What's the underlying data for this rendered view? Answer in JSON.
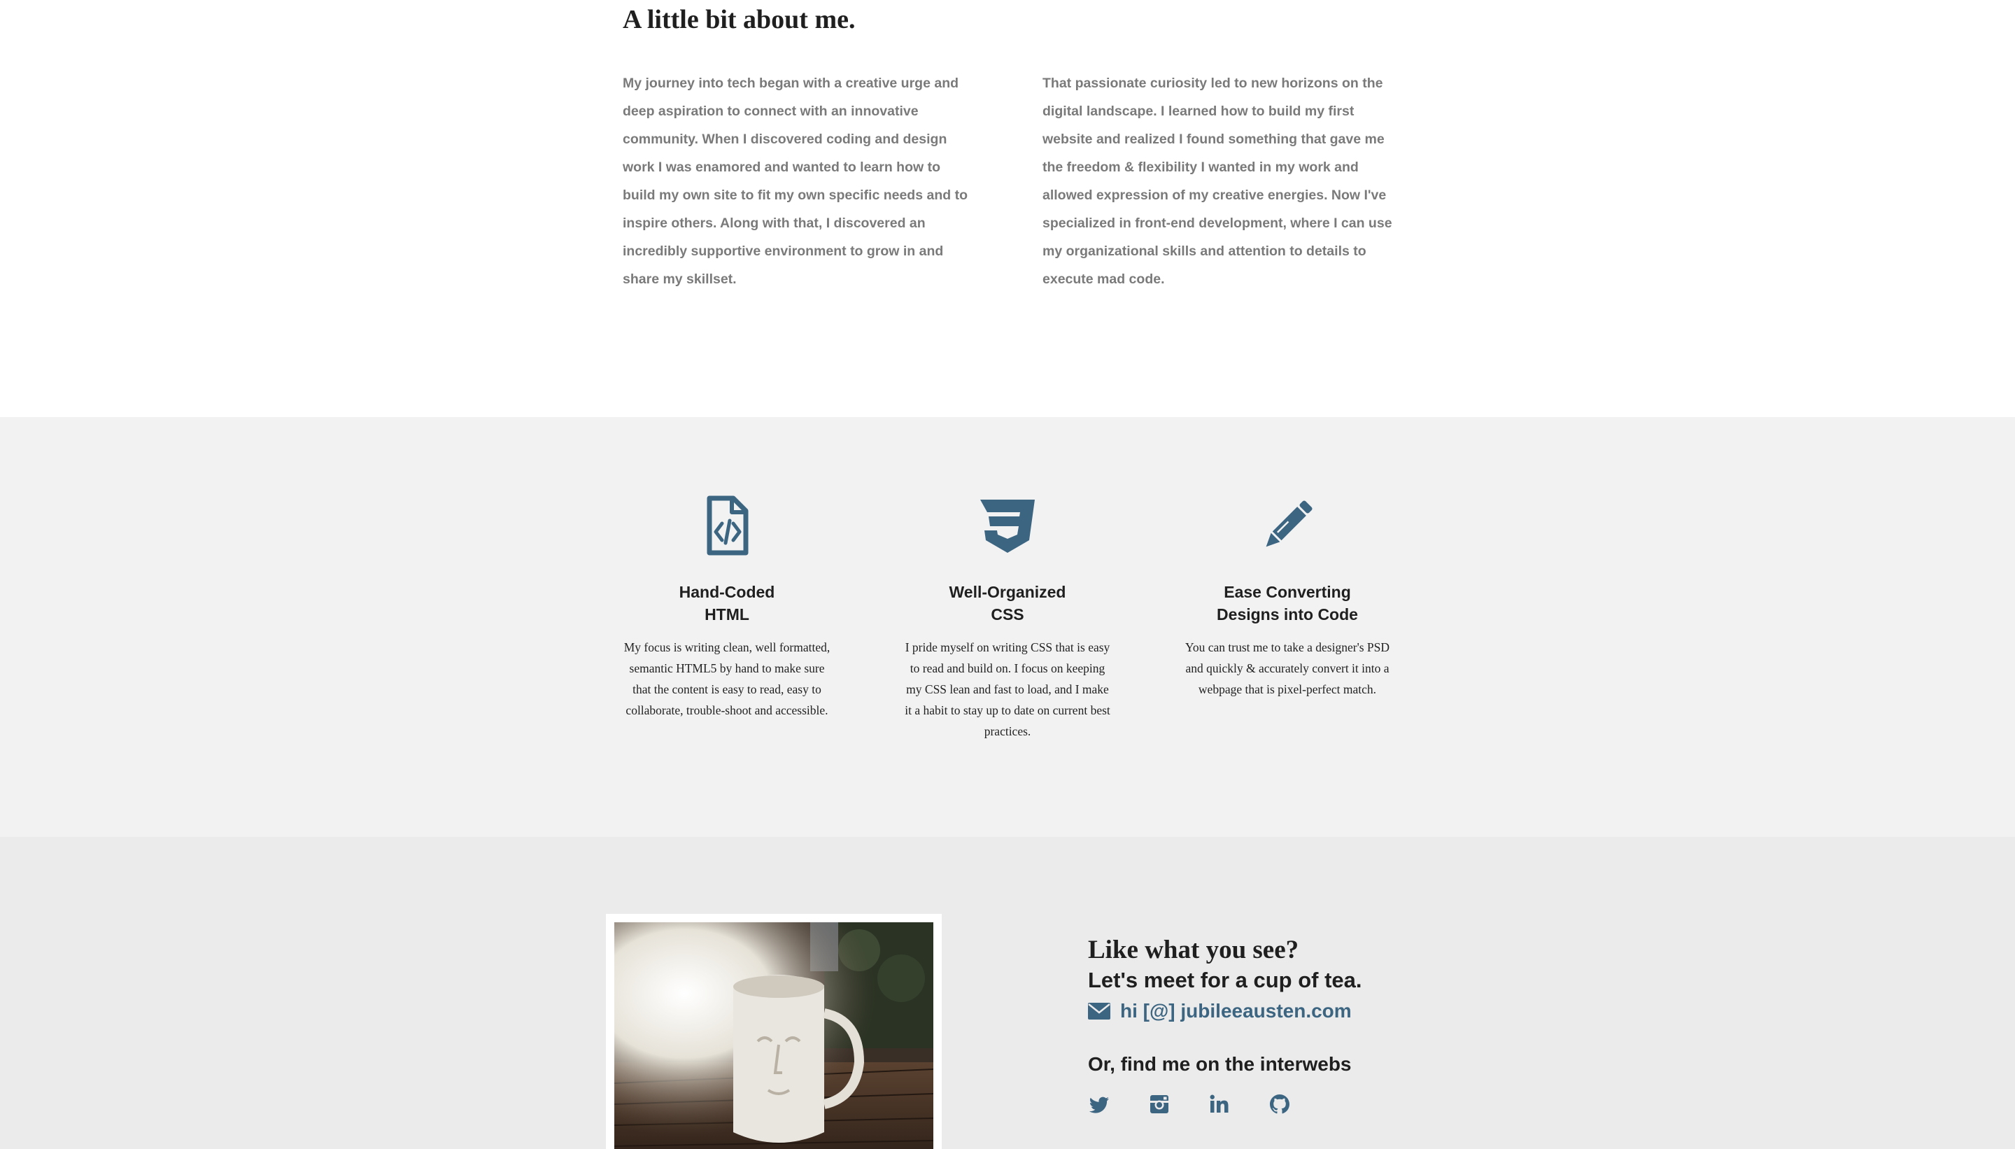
{
  "about": {
    "title": "A little bit about me.",
    "paragraph_left": "My journey into tech began with a creative urge and deep aspiration to connect with an innovative community. When I discovered coding and design work I was enamored and wanted to learn how to build my own site to fit my own specific needs and to inspire others. Along with that, I discovered an incredibly supportive environment to grow in and share my skillset.",
    "paragraph_right": "That passionate curiosity led to new horizons on the digital landscape. I learned how to build my first website and realized I found something that gave me the freedom & flexibility I wanted in my work and allowed expression of my creative energies. Now I've specialized in front-end development, where I can use my organizational skills and attention to details to execute mad code."
  },
  "skills": [
    {
      "icon": "file-code-icon",
      "title_line1": "Hand-Coded",
      "title_line2": "HTML",
      "text": "My focus is writing clean, well formatted, semantic HTML5 by hand to make sure that the content is easy to read, easy to collaborate, trouble-shoot and accessible."
    },
    {
      "icon": "css3-icon",
      "title_line1": "Well-Organized",
      "title_line2": "CSS",
      "text": "I pride myself on writing CSS that is easy to read and build on. I focus on keeping my CSS lean and fast to load, and I make it a habit to stay up to date on current best practices."
    },
    {
      "icon": "pencil-icon",
      "title_line1": "Ease Converting",
      "title_line2": "Designs into Code",
      "text": "You can trust me to take a designer's PSD and quickly & accurately convert it into a webpage that is pixel-perfect match."
    }
  ],
  "contact": {
    "heading": "Like what you see?",
    "subheading": "Let's meet for a cup of tea.",
    "email": "hi [@] jubileeausten.com",
    "interwebs": "Or, find me on the interwebs",
    "social_icons": [
      "twitter-icon",
      "instagram-icon",
      "linkedin-icon",
      "github-icon"
    ]
  },
  "colors": {
    "accent": "#3c6582",
    "about_text": "#7a7a7a",
    "skills_bg": "#f2f2f2",
    "contact_bg": "#ebebeb"
  }
}
